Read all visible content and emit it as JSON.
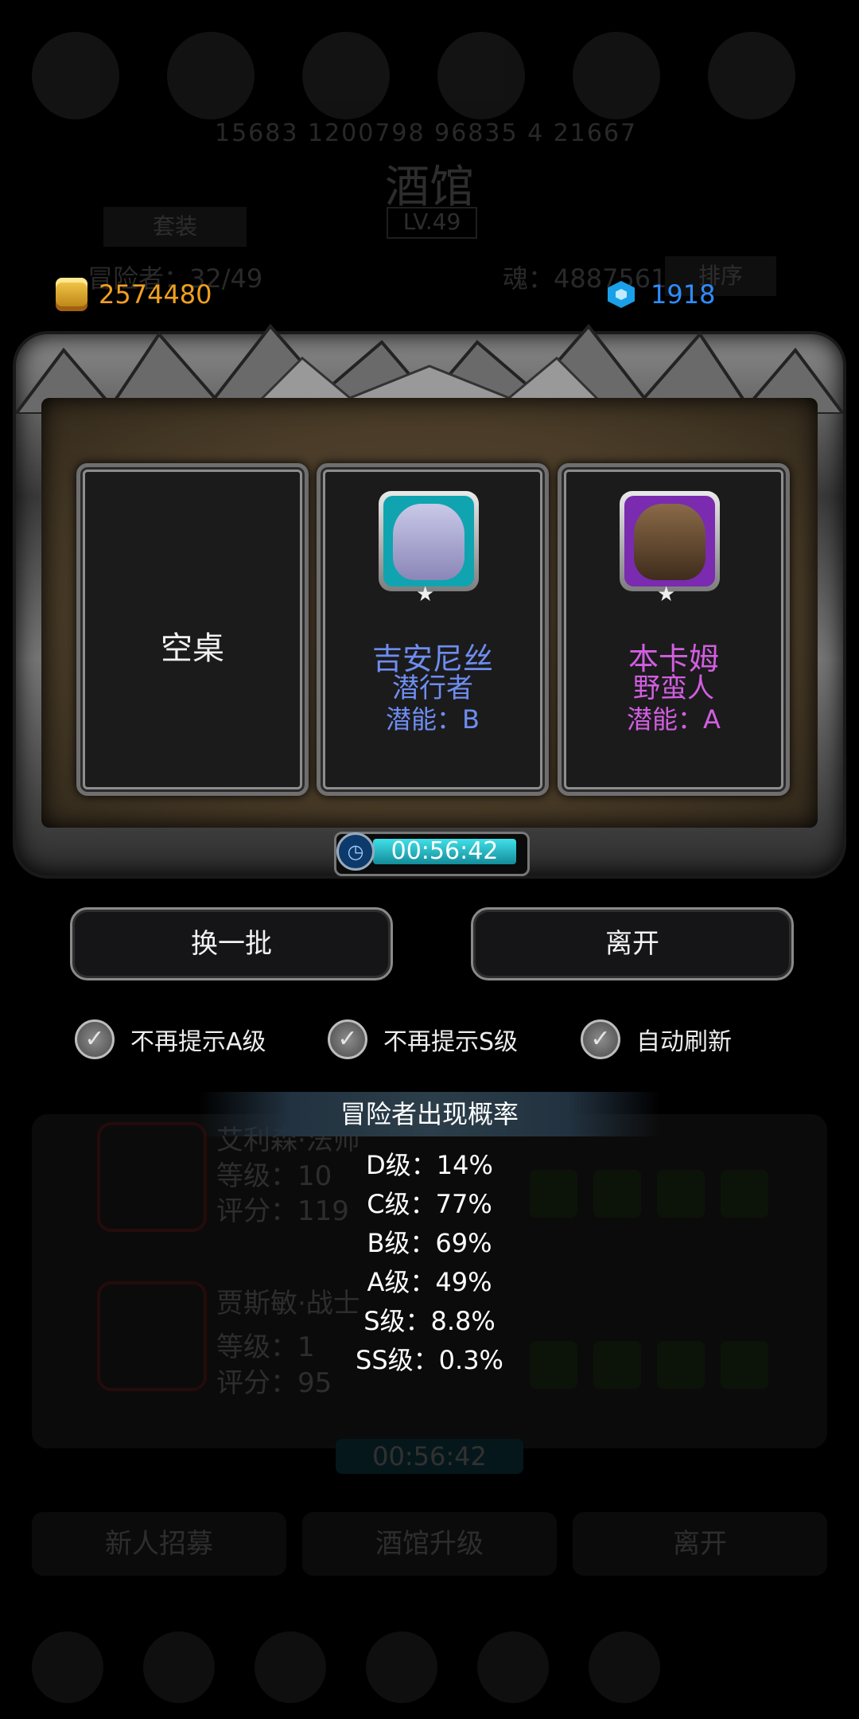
{
  "background": {
    "stats_text": "15683 1200798 96835 4 21667",
    "title": "酒馆",
    "level": "LV.49",
    "suit_button": "套装",
    "adventurers": "冒险者：32/49",
    "soul": "魂：4887561",
    "sort_button": "排序",
    "list": [
      {
        "name": "艾利森·法师",
        "level": "等级：10",
        "score": "评分：119"
      },
      {
        "name": "贾斯敏·战士",
        "level": "等级：1",
        "score": "评分：95"
      }
    ],
    "timer": "00:56:42",
    "buttons": [
      "新人招募",
      "酒馆升级",
      "离开"
    ]
  },
  "currency": {
    "gold": "2574480",
    "gems": "1918",
    "gold_color": "#f0a020",
    "gem_color": "#2f8cff"
  },
  "cards": [
    {
      "type": "empty",
      "label": "空桌"
    },
    {
      "type": "hero",
      "name": "吉安尼丝",
      "class": "潜行者",
      "potential": "潜能：B",
      "color": "#6e8df0",
      "frame": "teal",
      "star": "★"
    },
    {
      "type": "hero",
      "name": "本卡姆",
      "class": "野蛮人",
      "potential": "潜能：A",
      "color": "#d25ee0",
      "frame": "purple",
      "star": "★"
    }
  ],
  "timer": {
    "text": "00:56:42",
    "icon": "clock-icon"
  },
  "buttons": {
    "refresh": "换一批",
    "leave": "离开"
  },
  "options": [
    {
      "label": "不再提示A级",
      "checked": true
    },
    {
      "label": "不再提示S级",
      "checked": true
    },
    {
      "label": "自动刷新",
      "checked": true
    }
  ],
  "probability": {
    "title": "冒险者出现概率",
    "lines": [
      "D级：14%",
      "C级：77%",
      "B级：69%",
      "A级：49%",
      "S级：8.8%",
      "SS级：0.3%"
    ]
  }
}
